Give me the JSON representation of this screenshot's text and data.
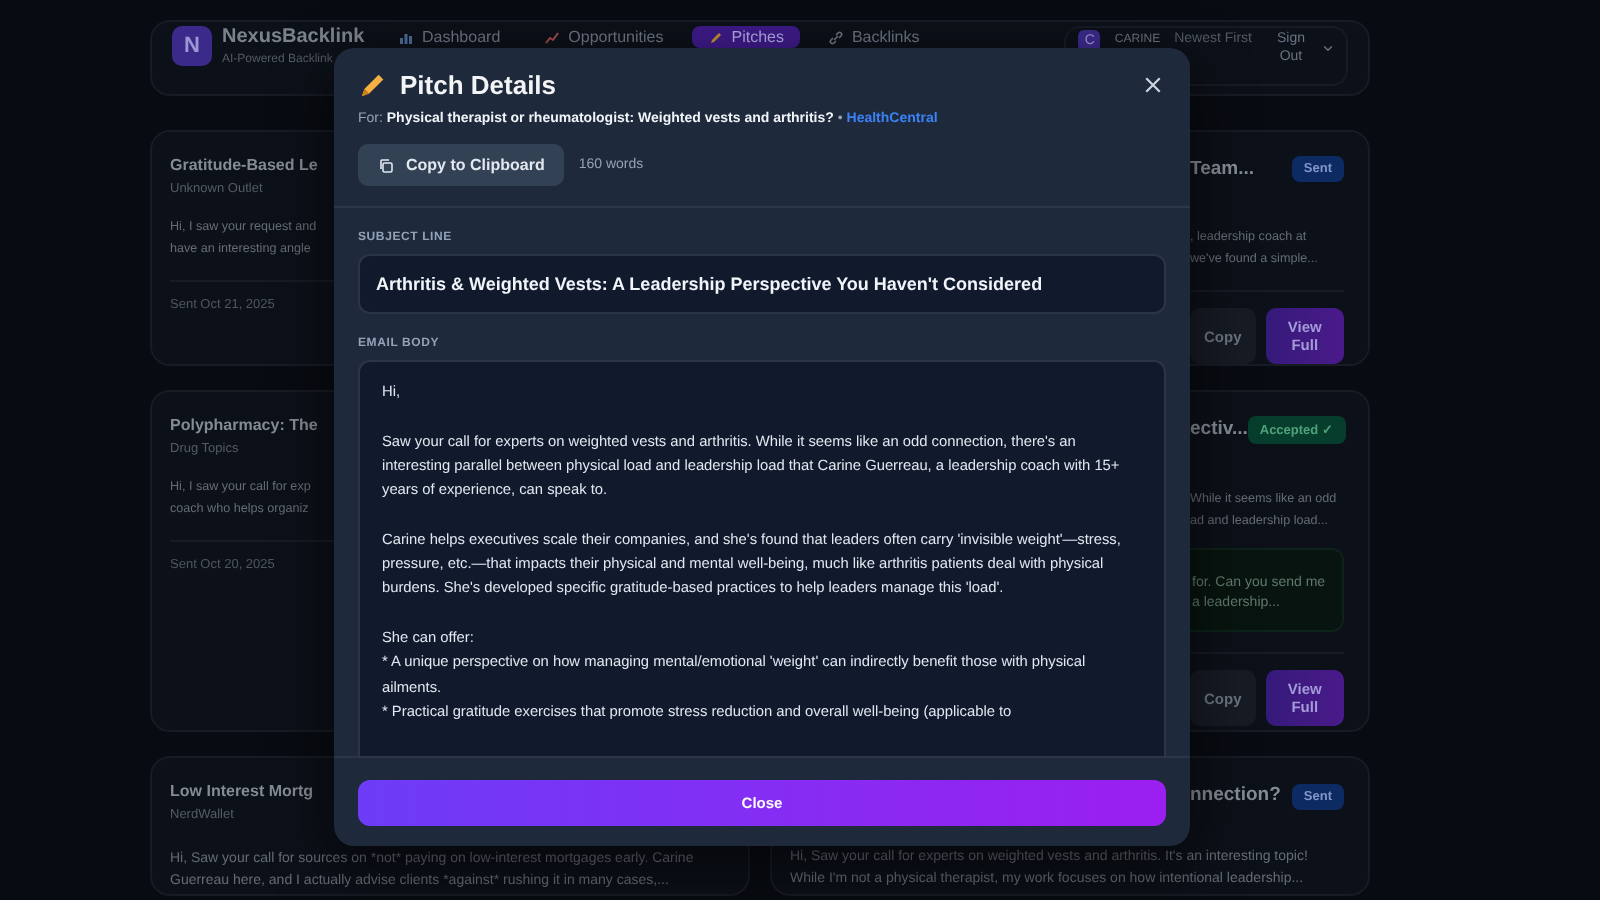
{
  "header": {
    "logo_letter": "N",
    "brand": "NexusBacklink",
    "tagline": "AI-Powered Backlink",
    "nav": [
      {
        "label": "Dashboard",
        "selected": false
      },
      {
        "label": "Opportunities",
        "selected": false
      },
      {
        "label": "Pitches",
        "selected": true
      },
      {
        "label": "Backlinks",
        "selected": false
      }
    ],
    "user": {
      "avatar_letter": "C",
      "name": "CARINE"
    },
    "sort": "Newest First",
    "sign_out": "Sign Out"
  },
  "pitch_cards_left": [
    {
      "title": "Gratitude-Based Le",
      "outlet": "Unknown Outlet",
      "body": [
        "Hi, I saw your request and",
        "have an interesting angle"
      ],
      "date": "Sent Oct 21, 2025"
    },
    {
      "title": "Polypharmacy: The",
      "outlet": "Drug Topics",
      "body": [
        "Hi, I saw your call for exp",
        "coach who helps organiz"
      ],
      "date": "Sent Oct 20, 2025"
    },
    {
      "title": "Low Interest Mortg",
      "outlet": "NerdWallet",
      "body": [
        "Hi, Saw your call for sources on *not* paying on low-interest mortgages early. Carine",
        "Guerreau here, and I actually advise clients *against* rushing it in many cases,..."
      ]
    }
  ],
  "pitch_cards_right": [
    {
      "title": "Team...",
      "badge": {
        "label": "Sent",
        "kind": "sent"
      },
      "body": [
        ", leadership coach at",
        "we've found a simple..."
      ],
      "buttons": [
        "Copy",
        "View Full"
      ]
    },
    {
      "title": "ectiv...",
      "badge": {
        "label": "Accepted ✓",
        "kind": "accepted"
      },
      "body": [
        "While it seems like an odd",
        "ad and leadership load..."
      ],
      "response": [
        "for. Can you send me",
        "a leadership..."
      ],
      "buttons": [
        "Copy",
        "View Full"
      ]
    },
    {
      "title": "nnection?",
      "badge": {
        "label": "Sent",
        "kind": "sent"
      },
      "body": [
        "Hi, Saw your call for experts on weighted vests and arthritis. It's an interesting topic!",
        "While I'm not a physical therapist, my work focuses on how intentional leadership..."
      ]
    }
  ],
  "modal": {
    "title": "Pitch Details",
    "for_label": "For:",
    "opportunity": "Physical therapist or rheumatologist: Weighted vests and arthritis?",
    "separator": "•",
    "outlet": "HealthCentral",
    "copy_button": "Copy to Clipboard",
    "word_count": "160 words",
    "subject_label": "SUBJECT LINE",
    "subject": "Arthritis & Weighted Vests: A Leadership Perspective You Haven't Considered",
    "body_label": "EMAIL BODY",
    "paragraphs": [
      "Hi,",
      "Saw your call for experts on weighted vests and arthritis. While it seems like an odd connection, there's an interesting parallel between physical load and leadership load that Carine Guerreau, a leadership coach with 15+ years of experience, can speak to.",
      "Carine helps executives scale their companies, and she's found that leaders often carry 'invisible weight'—stress, pressure, etc.—that impacts their physical and mental well-being, much like arthritis patients deal with physical burdens. She's developed specific gratitude-based practices to help leaders manage this 'load'."
    ],
    "offer_intro": "She can offer:",
    "bullets": [
      "*  A unique perspective on how managing mental/emotional 'weight' can indirectly benefit those with physical ailments.",
      "*  Practical gratitude exercises that promote stress reduction and overall well-being (applicable to"
    ],
    "close_button": "Close"
  }
}
